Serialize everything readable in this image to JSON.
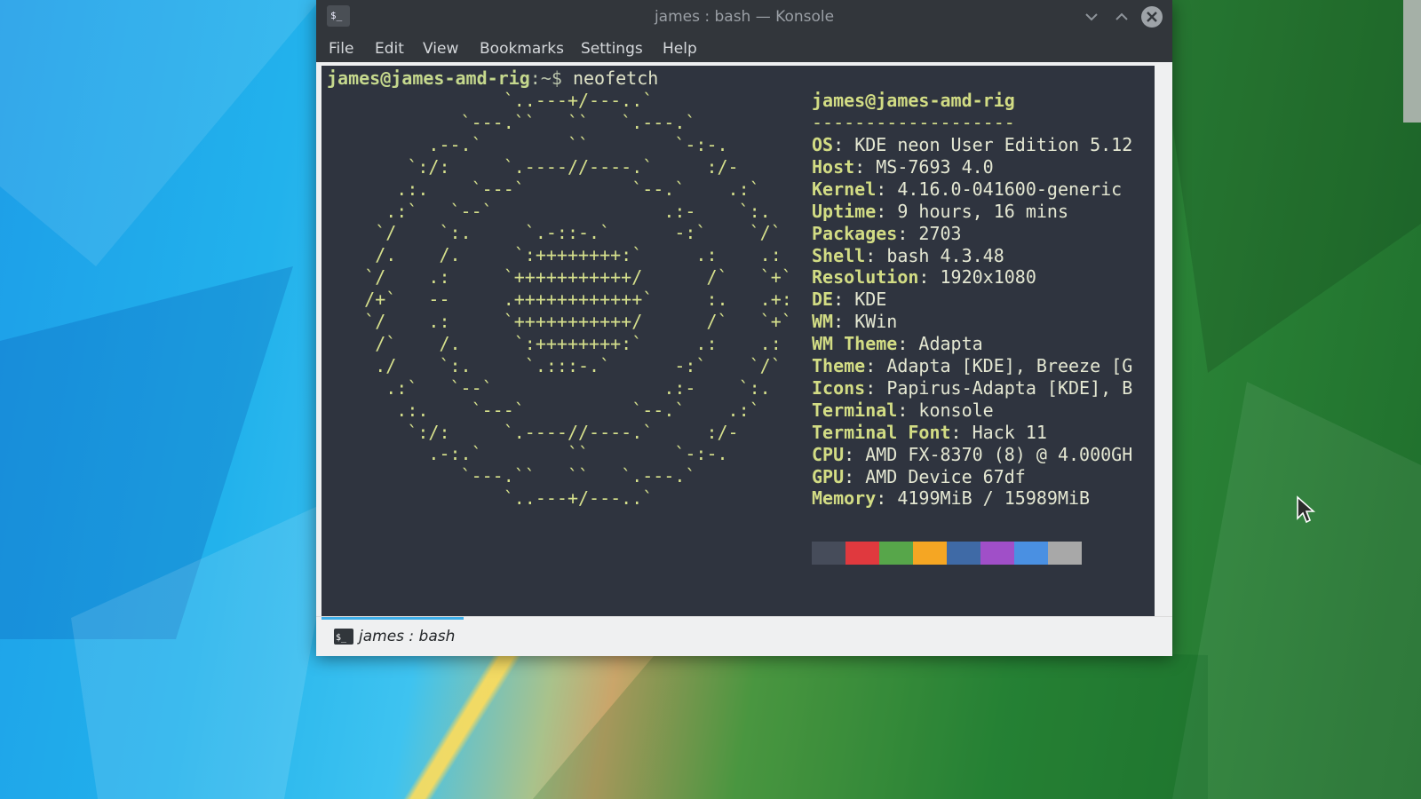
{
  "window": {
    "title": "james : bash — Konsole",
    "menu": [
      "File",
      "Edit",
      "View",
      "Bookmarks",
      "Settings",
      "Help"
    ]
  },
  "terminal": {
    "prompt_user": "james@james-amd-rig",
    "prompt_path": ":~$",
    "command": "neofetch",
    "ascii_art": [
      "                 `..---+/---..`",
      "             `---.``   ``   `.---.`",
      "          .--.`        ``        `-:-.",
      "        `:/:     `.----//----.`     :/-",
      "       .:.    `---`          `--.`    .:`",
      "      .:`   `--`                .:-    `:.",
      "     `/    `:.     `.-::-.`      -:`    `/`",
      "     /.    /.     `:++++++++:`     .:    .:",
      "    `/    .:     `+++++++++++/      /`   `+`",
      "    /+`   --     .++++++++++++`     :.   .+:",
      "    `/    .:     `+++++++++++/      /`   `+`",
      "     /`    /.     `:++++++++:`     .:    .:",
      "     ./    `:.     `.:::-.`      -:`    `/`",
      "      .:`   `--`                .:-    `:.",
      "       .:.    `---`          `--.`    .:`",
      "        `:/:     `.----//----.`     :/-",
      "          .-:.`        ``        `-:-.",
      "             `---.``   ``   `.---.`",
      "                 `..---+/---..`"
    ],
    "info_header": "james@james-amd-rig",
    "info_separator": "-------------------",
    "info": [
      {
        "key": "OS",
        "value": "KDE neon User Edition 5.12"
      },
      {
        "key": "Host",
        "value": "MS-7693 4.0"
      },
      {
        "key": "Kernel",
        "value": "4.16.0-041600-generic"
      },
      {
        "key": "Uptime",
        "value": "9 hours, 16 mins"
      },
      {
        "key": "Packages",
        "value": "2703"
      },
      {
        "key": "Shell",
        "value": "bash 4.3.48"
      },
      {
        "key": "Resolution",
        "value": "1920x1080"
      },
      {
        "key": "DE",
        "value": "KDE"
      },
      {
        "key": "WM",
        "value": "KWin"
      },
      {
        "key": "WM Theme",
        "value": "Adapta"
      },
      {
        "key": "Theme",
        "value": "Adapta [KDE], Breeze [G"
      },
      {
        "key": "Icons",
        "value": "Papirus-Adapta [KDE], B"
      },
      {
        "key": "Terminal",
        "value": "konsole"
      },
      {
        "key": "Terminal Font",
        "value": "Hack 11"
      },
      {
        "key": "CPU",
        "value": "AMD FX-8370 (8) @ 4.000GH"
      },
      {
        "key": "GPU",
        "value": "AMD Device 67df"
      },
      {
        "key": "Memory",
        "value": "4199MiB / 15989MiB"
      }
    ],
    "color_blocks": [
      "#464c5a",
      "#e0393e",
      "#57a64a",
      "#f5a623",
      "#3f6aa6",
      "#a04fc8",
      "#4a90e2",
      "#a8a8a8"
    ]
  },
  "tab": {
    "label": "james : bash"
  },
  "colors": {
    "accent": "#3daee9",
    "titlebar": "#32363b",
    "terminal_bg": "#2f343f"
  }
}
